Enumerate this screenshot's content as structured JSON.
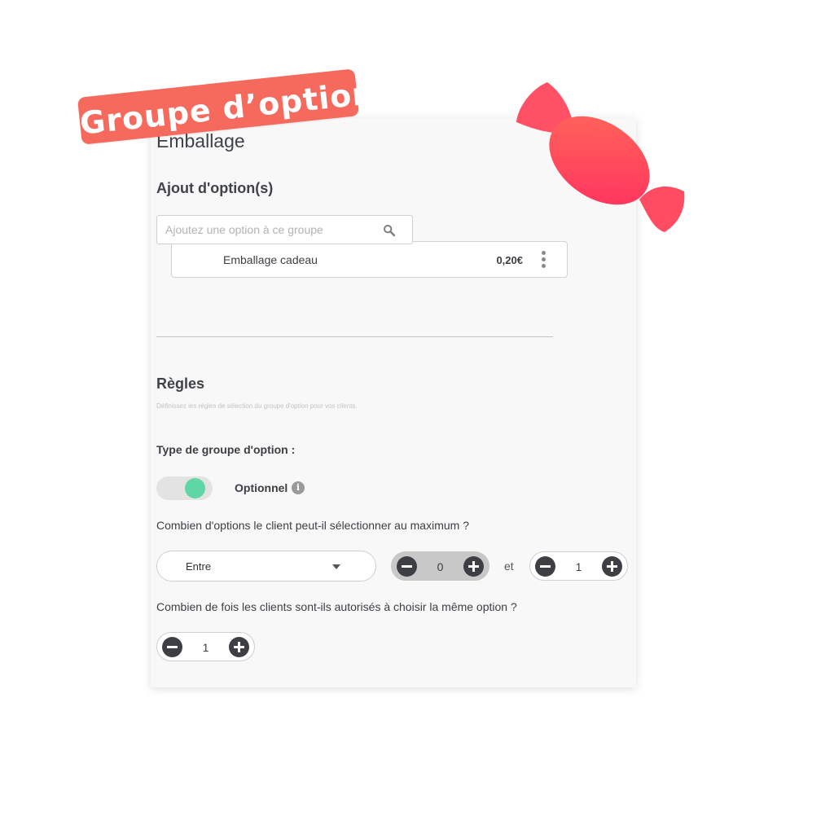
{
  "badge": {
    "text": "Groupe d’option",
    "color": "#f56a5d"
  },
  "page": {
    "title": "Emballage"
  },
  "add_options": {
    "title": "Ajout d'option(s)",
    "search_placeholder": "Ajoutez une option à ce groupe",
    "search_icon": "search-icon",
    "options": [
      {
        "name": "Emballage cadeau",
        "price": "0,20€"
      }
    ]
  },
  "rules": {
    "title": "Règles",
    "hint": "Définissez les règles de sélection du groupe d'option pour vos clients.",
    "type_label": "Type de groupe d'option :",
    "toggle": {
      "label": "Optionnel",
      "on": true,
      "color": "#5fd6a5"
    },
    "max_question": "Combien d'options le client peut-il sélectionner au maximum ?",
    "range_mode": "Entre",
    "min_value": "0",
    "and_label": "et",
    "max_value": "1",
    "repeat_question": "Combien de fois les clients sont-ils autorisés à choisir la même option ?",
    "repeat_value": "1"
  },
  "decoration": {
    "candy_color": "#ff4057"
  }
}
